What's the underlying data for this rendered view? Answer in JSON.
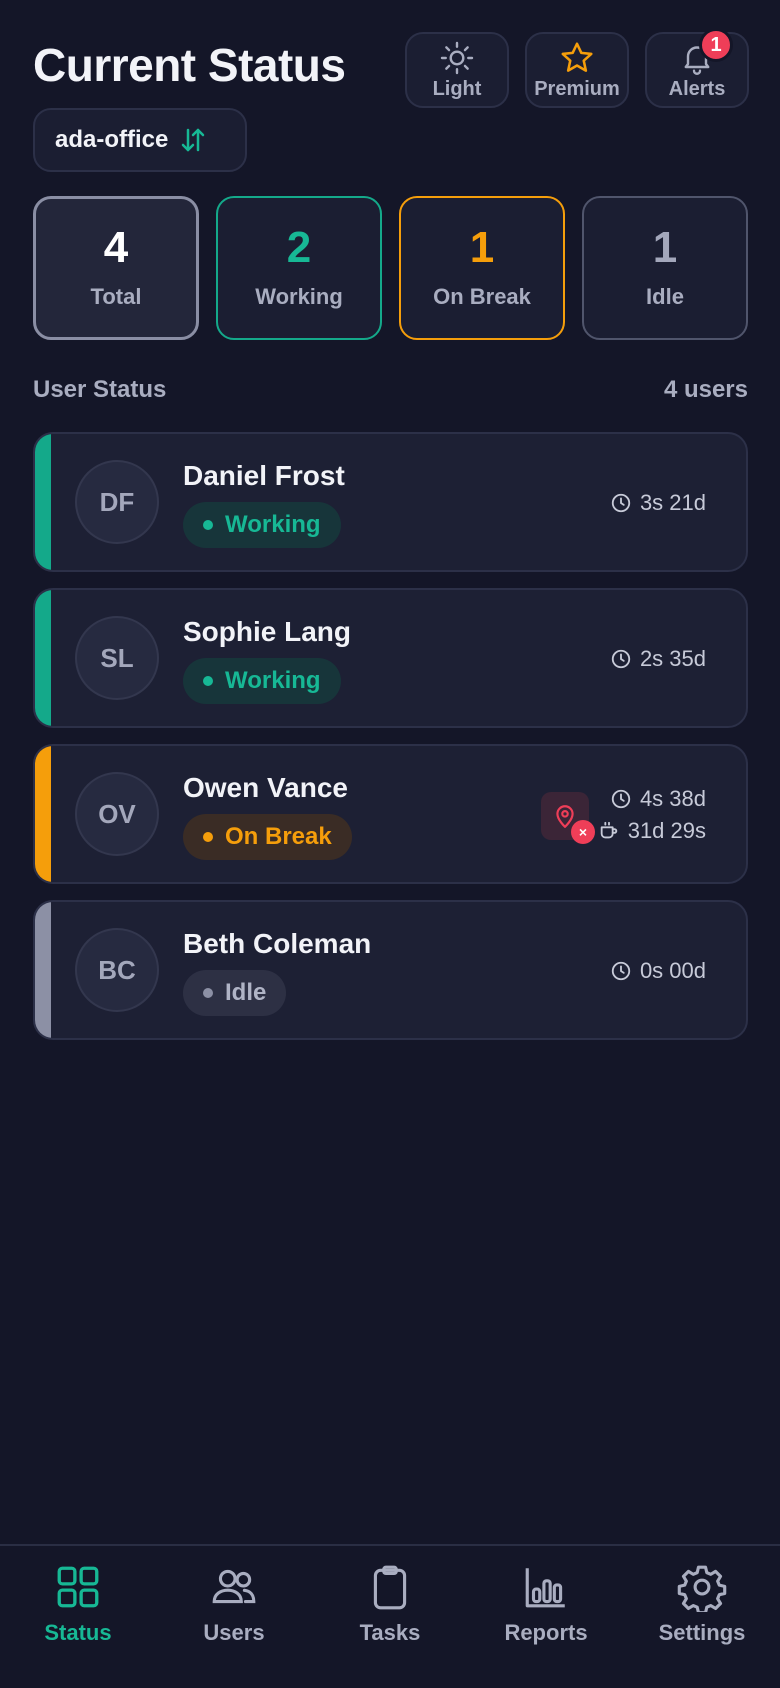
{
  "header": {
    "title": "Current Status",
    "buttons": [
      {
        "label": "Light",
        "icon": "sun-icon"
      },
      {
        "label": "Premium",
        "icon": "star-icon"
      },
      {
        "label": "Alerts",
        "icon": "bell-icon",
        "badge": "1"
      }
    ],
    "office": {
      "name": "ada-office",
      "icon": "swap-vertical-icon"
    }
  },
  "summary": [
    {
      "value": "4",
      "label": "Total"
    },
    {
      "value": "2",
      "label": "Working"
    },
    {
      "value": "1",
      "label": "On Break"
    },
    {
      "value": "1",
      "label": "Idle"
    }
  ],
  "section": {
    "title": "User Status",
    "count": "4 users"
  },
  "users": [
    {
      "initials": "DF",
      "name": "Daniel Frost",
      "status": "Working",
      "work_time": "3s 21d"
    },
    {
      "initials": "SL",
      "name": "Sophie Lang",
      "status": "Working",
      "work_time": "2s 35d"
    },
    {
      "initials": "OV",
      "name": "Owen Vance",
      "status": "On Break",
      "work_time": "4s 38d",
      "break_time": "31d 29s",
      "location_alert": "×"
    },
    {
      "initials": "BC",
      "name": "Beth Coleman",
      "status": "Idle",
      "work_time": "0s 00d"
    }
  ],
  "nav": [
    {
      "label": "Status",
      "icon": "grid-icon",
      "active": true
    },
    {
      "label": "Users",
      "icon": "users-icon"
    },
    {
      "label": "Tasks",
      "icon": "clipboard-icon"
    },
    {
      "label": "Reports",
      "icon": "bar-chart-icon"
    },
    {
      "label": "Settings",
      "icon": "gear-icon"
    }
  ],
  "colors": {
    "background": "#141628",
    "working": "#17b895",
    "on_break": "#f59e0b",
    "idle": "#8c90a5",
    "alert": "#ef3e58"
  }
}
